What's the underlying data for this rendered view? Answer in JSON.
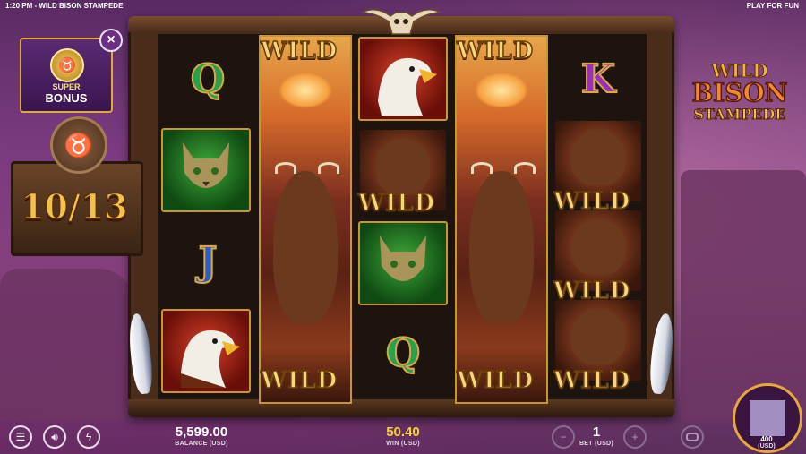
{
  "status_bar": {
    "left": "1:20 PM - WILD BISON STAMPEDE",
    "right": "PLAY FOR FUN"
  },
  "bonus_panel": {
    "line1": "SUPER",
    "line2": "BONUS",
    "close_glyph": "×"
  },
  "free_spins": {
    "counter": "10/13"
  },
  "logo": {
    "line1": "WILD",
    "line2": "BISON",
    "line3": "STAMPEDE"
  },
  "reels": {
    "wild_label": "WILD",
    "q_label": "Q",
    "j_label": "J",
    "k_label": "K"
  },
  "footer": {
    "balance_value": "5,599.00",
    "balance_label": "BALANCE (USD)",
    "win_value": "50.40",
    "win_label": "WIN (USD)",
    "bet_value": "1",
    "bet_label": "BET (USD)",
    "minus": "−",
    "plus": "+",
    "spin_value": "400",
    "spin_label": "(USD)"
  },
  "colors": {
    "accent_gold": "#e7a93a",
    "purple_bg": "#7c3f84",
    "win_yellow": "#f6d13a"
  },
  "icons": [
    "menu-icon",
    "sound-icon",
    "turbo-icon",
    "autoplay-icon",
    "bison-medal-icon",
    "skull-icon"
  ]
}
